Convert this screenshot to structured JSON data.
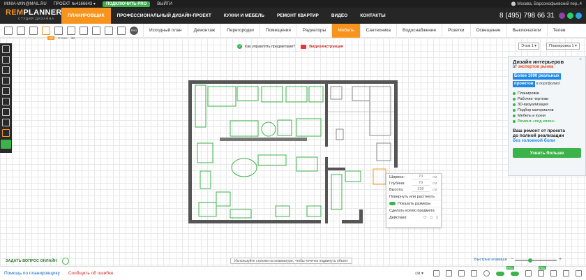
{
  "topbar": {
    "email": "MINIA-WIN@MAIL.RU",
    "project": "ПРОЕКТ №4166643",
    "pro_button": "ПОДКЛЮЧИТЬ PRO",
    "logout": "ВЫЙТИ",
    "location": "Москва, Варсонофьевский пер.,4"
  },
  "logo": {
    "name_a": "REM",
    "name_b": "PLANNER",
    "tagline": "СТУДИЯ ДИЗАЙНА"
  },
  "nav": {
    "items": [
      "ПЛАНИРОВЩИК",
      "ПРОФЕССИОНАЛЬНЫЙ ДИЗАЙН-ПРОЕКТ",
      "КУХНИ И МЕБЕЛЬ",
      "РЕМОНТ КВАРТИР",
      "ВИДЕО",
      "КОНТАКТЫ"
    ],
    "phone": "8 (495) 798 66 31"
  },
  "toolbar": {
    "sub_labels": {
      "badge": "2D",
      "walls": "Стены",
      "three_d": "3D"
    },
    "pro_label": "PRO",
    "categories": [
      "Исходный план",
      "Демонтаж",
      "Перегородки",
      "Помещения",
      "Радиаторы",
      "Мебель",
      "Сантехника",
      "Водоснабжение",
      "Розетки",
      "Освещение",
      "Выключатели",
      "Телев"
    ]
  },
  "help": {
    "question_mark": "?",
    "manage_label": "Как управлять предметами?",
    "video_label": "Видеоинструкция"
  },
  "floors": {
    "floor": "Этаж 1",
    "plan": "Планировка 1"
  },
  "ad": {
    "title": "Дизайн интерьеров",
    "title_from": "от",
    "title_accent": "экспертов рынка",
    "more": "Более 1000 реальных",
    "more2": "проектов",
    "more_tail": "в портфолио!",
    "items": [
      "Планировки",
      "Рабочие чертежи",
      "3D-визуализация",
      "Подбор материалов",
      "Мебель и кухни",
      "Ремонт «под ключ»"
    ],
    "repair": "Ваш ремонт от проекта",
    "repair2": "до полной реализации",
    "repair3": "без головной боли",
    "button": "Узнать больше",
    "close": "×"
  },
  "context_menu": {
    "width_label": "Ширина:",
    "width_value": "70",
    "width_unit": "см",
    "depth_label": "Глубина:",
    "depth_value": "70",
    "depth_unit": "см",
    "height_label": "Высота:",
    "height_value": "230",
    "height_unit": "см",
    "rotate": "Повернуть или растянуть",
    "show_sizes": "Показать размеры",
    "copy": "Сделать копию предмета",
    "actions": "Действия:"
  },
  "hint": "Используйте стрелки на клавиатуре, чтобы точечно подвинуть объект",
  "ask_question": "ЗАДАТЬ ВОПРОС ОНЛАЙН",
  "fast_keys": "Быстрые клавиши",
  "zoom": {
    "minus": "−",
    "plus": "+",
    "level": 0.35
  },
  "bottom": {
    "help_link": "Помощь по планировщику",
    "report_link": "Сообщить об ошибке",
    "units": "см",
    "pro_badge": "PRO"
  },
  "colors": {
    "accent": "#f7941d",
    "green": "#3bb34a",
    "dark": "#262626"
  }
}
